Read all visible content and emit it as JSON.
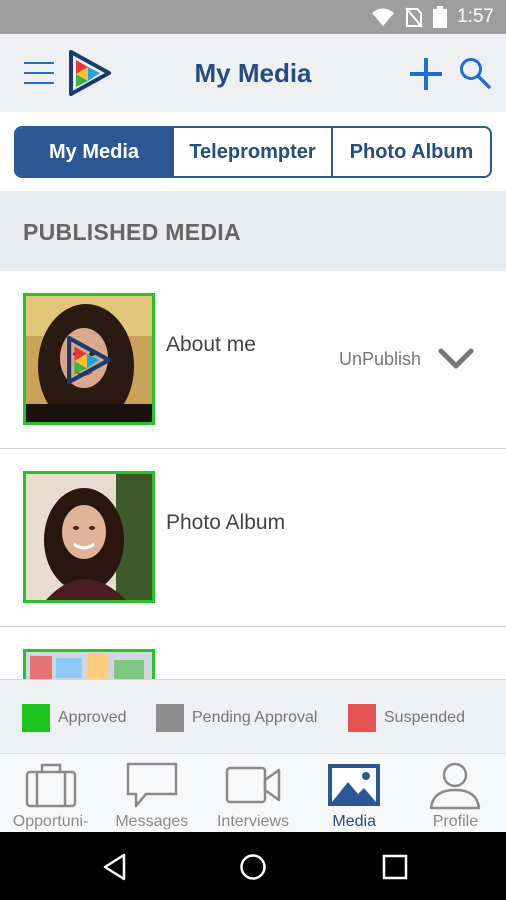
{
  "status_bar": {
    "time": "1:57"
  },
  "header": {
    "title": "My Media"
  },
  "tabs": [
    {
      "label": "My Media",
      "active": true
    },
    {
      "label": "Teleprompter",
      "active": false
    },
    {
      "label": "Photo Album",
      "active": false
    }
  ],
  "section": {
    "title": "PUBLISHED MEDIA"
  },
  "media_items": [
    {
      "title": "About me",
      "action_label": "UnPublish",
      "type": "video",
      "status": "Approved"
    },
    {
      "title": "Photo Album",
      "action_label": "",
      "type": "photo",
      "status": "Approved"
    },
    {
      "title": "",
      "action_label": "",
      "type": "photo",
      "status": "Approved"
    }
  ],
  "legend": [
    {
      "label": "Approved",
      "color": "#1ec51e"
    },
    {
      "label": "Pending Approval",
      "color": "#8e8e8e"
    },
    {
      "label": "Suspended",
      "color": "#e65353"
    }
  ],
  "bottom_nav": [
    {
      "label": "Opportuni-",
      "icon": "briefcase-icon",
      "active": false
    },
    {
      "label": "Messages",
      "icon": "chat-bubble-icon",
      "active": false
    },
    {
      "label": "Interviews",
      "icon": "video-camera-icon",
      "active": false
    },
    {
      "label": "Media",
      "icon": "image-icon",
      "active": true
    },
    {
      "label": "Profile",
      "icon": "user-icon",
      "active": false
    }
  ],
  "colors": {
    "primary": "#2b5794",
    "accent": "#1f6fd0",
    "approved": "#1ec51e",
    "pending": "#8e8e8e",
    "suspended": "#e65353"
  }
}
